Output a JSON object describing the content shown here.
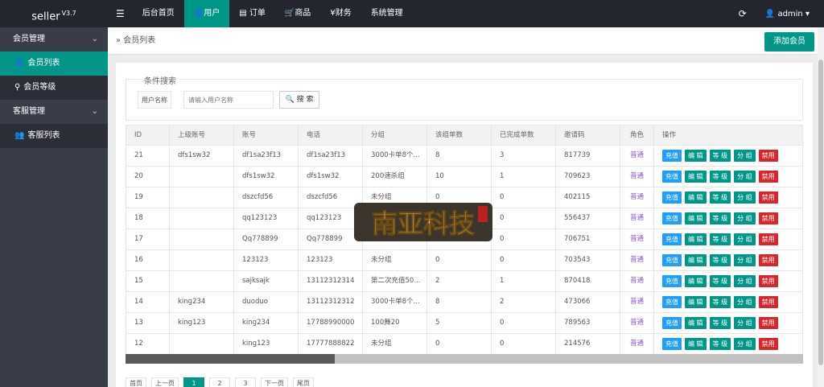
{
  "app": {
    "name": "seller",
    "version": "V3.7"
  },
  "topnav": {
    "menu_icon": "menu-icon",
    "items": [
      {
        "label": "后台首页",
        "icon": ""
      },
      {
        "label": "用户",
        "icon": "user-icon",
        "active": true
      },
      {
        "label": "订单",
        "icon": "order-icon"
      },
      {
        "label": "商品",
        "icon": "cart-icon"
      },
      {
        "label": "财务",
        "icon": "yen-icon"
      },
      {
        "label": "系统管理",
        "icon": ""
      }
    ],
    "refresh_icon": "refresh-icon",
    "user": "admin"
  },
  "sidebar": {
    "groups": [
      {
        "label": "会员管理",
        "items": [
          {
            "label": "会员列表",
            "active": true,
            "icon": "user-icon"
          },
          {
            "label": "会员等级",
            "icon": "key-icon"
          }
        ]
      },
      {
        "label": "客服管理",
        "items": [
          {
            "label": "客服列表",
            "icon": "users-icon"
          }
        ]
      }
    ]
  },
  "breadcrumb": {
    "label": "会员列表"
  },
  "add_button": "添加会员",
  "search": {
    "legend": "条件搜索",
    "label": "用户名称",
    "placeholder": "请输入用户名称",
    "button": "搜 索"
  },
  "table": {
    "headers": [
      "ID",
      "上级账号",
      "账号",
      "电话",
      "分组",
      "该组单数",
      "已完成单数",
      "邀请码",
      "角色",
      "操作"
    ],
    "rows": [
      [
        "21",
        "dfs1sw32",
        "df1sa23f13",
        "df1sa23f13",
        "3000卡单8个...",
        "8",
        "3",
        "817739",
        "普通"
      ],
      [
        "20",
        "",
        "dfs1sw32",
        "dfs1sw32",
        "200速杀组",
        "10",
        "1",
        "709623",
        "普通"
      ],
      [
        "19",
        "",
        "dszcfd56",
        "dszcfd56",
        "未分组",
        "0",
        "0",
        "402115",
        "普通"
      ],
      [
        "18",
        "",
        "qq123123",
        "qq123123",
        "",
        "",
        "0",
        "556437",
        "普通"
      ],
      [
        "17",
        "",
        "Qq778899",
        "Qq778899",
        "",
        "",
        "0",
        "706751",
        "普通"
      ],
      [
        "16",
        "",
        "123123",
        "123123",
        "未分组",
        "0",
        "0",
        "703543",
        "普通"
      ],
      [
        "15",
        "",
        "sajksajk",
        "13112312314",
        "第二次充值50...",
        "2",
        "1",
        "870418",
        "普通"
      ],
      [
        "14",
        "king234",
        "duoduo",
        "13112312312",
        "3000卡单8个...",
        "8",
        "2",
        "473066",
        "普通"
      ],
      [
        "13",
        "king123",
        "king234",
        "17788990000",
        "100舞20",
        "5",
        "0",
        "789563",
        "普通"
      ],
      [
        "12",
        "",
        "king123",
        "17777888822",
        "未分组",
        "0",
        "0",
        "214576",
        "普通"
      ]
    ],
    "ops": [
      "充值",
      "编 辑",
      "等 级",
      "分 组",
      "禁用"
    ]
  },
  "pager": [
    "首页",
    "上一页",
    "1",
    "2",
    "3",
    "下一页",
    "尾页"
  ],
  "watermark": "南亚科技"
}
